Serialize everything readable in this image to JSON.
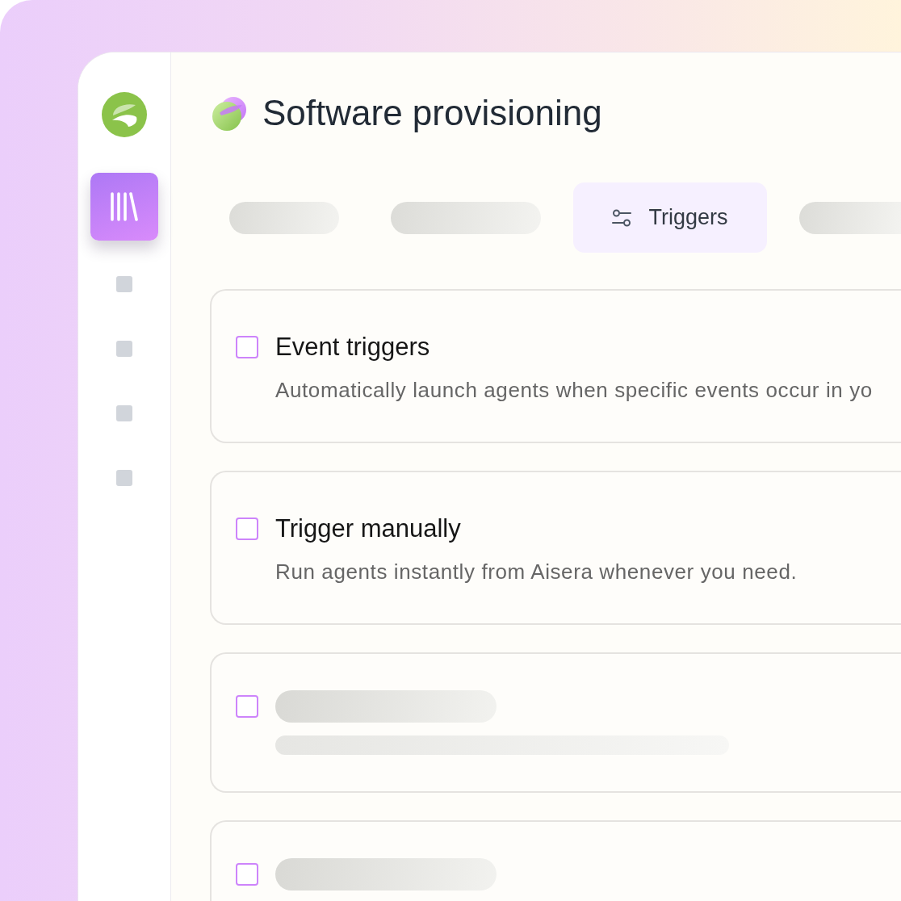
{
  "sidebar": {
    "nav": [
      {
        "kind": "library",
        "selected": true
      },
      {
        "kind": "placeholder",
        "selected": false
      },
      {
        "kind": "placeholder",
        "selected": false
      },
      {
        "kind": "placeholder",
        "selected": false
      },
      {
        "kind": "placeholder",
        "selected": false
      }
    ]
  },
  "header": {
    "title": "Software provisioning"
  },
  "tabs": [
    {
      "kind": "placeholder",
      "selected": false
    },
    {
      "kind": "placeholder",
      "selected": false
    },
    {
      "kind": "tab",
      "label": "Triggers",
      "selected": true
    },
    {
      "kind": "placeholder",
      "selected": false
    }
  ],
  "options": [
    {
      "kind": "option",
      "checked": false,
      "title": "Event triggers",
      "description": "Automatically launch agents when specific events occur in yo"
    },
    {
      "kind": "option",
      "checked": false,
      "title": "Trigger manually",
      "description": "Run agents instantly from Aisera whenever you need."
    },
    {
      "kind": "skeleton",
      "checked": false,
      "has_description": true
    },
    {
      "kind": "skeleton",
      "checked": false
    }
  ]
}
